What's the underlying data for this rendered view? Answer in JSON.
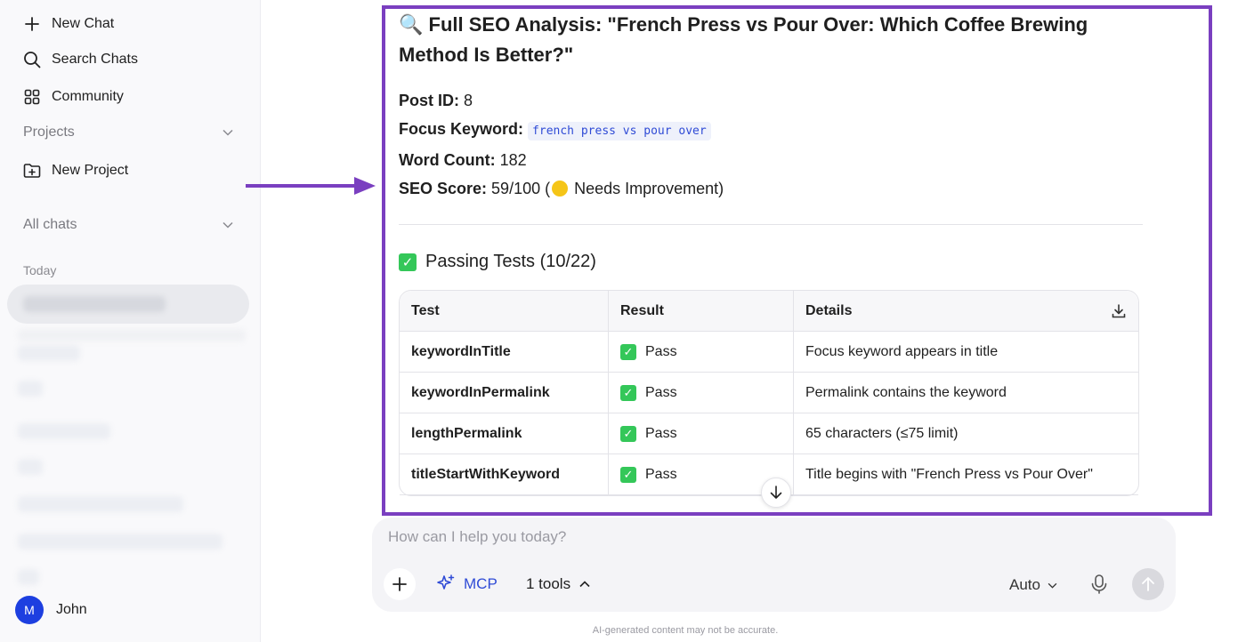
{
  "sidebar": {
    "new_chat": "New Chat",
    "search_chats": "Search Chats",
    "community": "Community",
    "projects": "Projects",
    "new_project": "New Project",
    "all_chats": "All chats",
    "today": "Today",
    "user_initial": "M",
    "user_name": "John"
  },
  "analysis": {
    "icon": "magnifier-emoji",
    "title": "🔍 Full SEO Analysis: \"French Press vs Pour Over: Which Coffee Brewing Method Is Better?\"",
    "post_id_label": "Post ID:",
    "post_id": " 8",
    "focus_keyword_label": "Focus Keyword:",
    "focus_keyword": "french press vs pour over",
    "word_count_label": "Word Count:",
    "word_count": " 182",
    "seo_score_label": "SEO Score:",
    "seo_score": " 59/100 (",
    "seo_status": " Needs Improvement)",
    "status_color": "#f5c518",
    "passing_heading": "Passing Tests (10/22)",
    "table": {
      "headers": [
        "Test",
        "Result",
        "Details"
      ],
      "rows": [
        {
          "test": "keywordInTitle",
          "result": "Pass",
          "details": "Focus keyword appears in title"
        },
        {
          "test": "keywordInPermalink",
          "result": "Pass",
          "details": "Permalink contains the keyword"
        },
        {
          "test": "lengthPermalink",
          "result": "Pass",
          "details": "65 characters (≤75 limit)"
        },
        {
          "test": "titleStartWithKeyword",
          "result": "Pass",
          "details": "Title begins with \"French Press vs Pour Over\""
        }
      ]
    }
  },
  "composer": {
    "placeholder": "How can I help you today?",
    "mcp_label": "MCP",
    "tools_label": "1 tools",
    "model_label": "Auto"
  },
  "footer": {
    "disclaimer": "AI-generated content may not be accurate."
  },
  "colors": {
    "accent_purple": "#7a3fc0",
    "brand_blue": "#2f4bd6",
    "pass_green": "#34c759"
  }
}
